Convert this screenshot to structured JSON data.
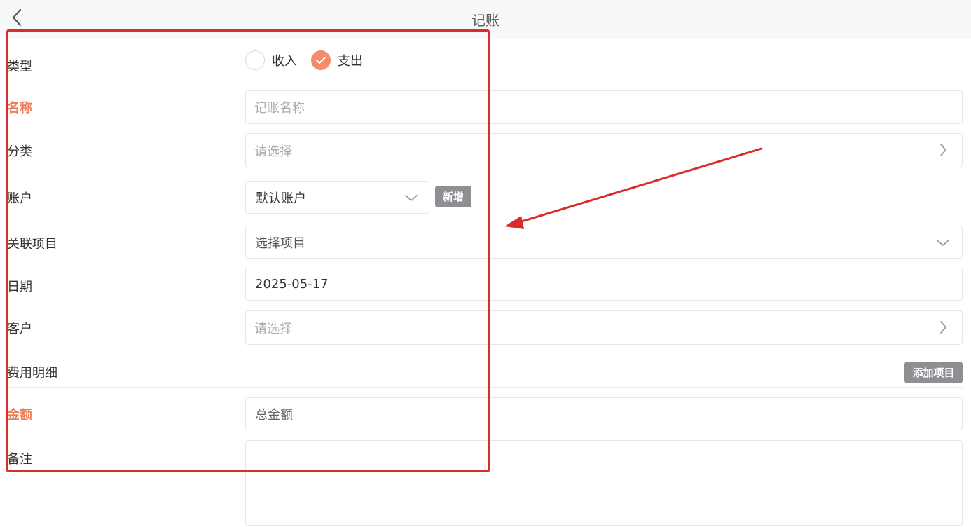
{
  "header": {
    "title": "记账",
    "back_icon": "chevron-left-icon"
  },
  "form": {
    "type": {
      "label": "类型",
      "options": [
        {
          "label": "收入",
          "checked": false
        },
        {
          "label": "支出",
          "checked": true
        }
      ]
    },
    "name": {
      "label": "名称",
      "required": true,
      "placeholder": "记账名称"
    },
    "category": {
      "label": "分类",
      "placeholder": "请选择",
      "icon": "chevron-right-icon"
    },
    "account": {
      "label": "账户",
      "value": "默认账户",
      "icon": "chevron-down-icon",
      "add_button": "新增"
    },
    "project": {
      "label": "关联项目",
      "placeholder": "选择项目",
      "icon": "chevron-down-icon"
    },
    "date": {
      "label": "日期",
      "value": "2025-05-17"
    },
    "customer": {
      "label": "客户",
      "placeholder": "请选择",
      "icon": "chevron-right-icon"
    },
    "expense_details": {
      "label": "费用明细",
      "add_button": "添加项目"
    },
    "amount": {
      "label": "金额",
      "required": true,
      "placeholder": "总金额"
    },
    "remark": {
      "label": "备注",
      "value": ""
    }
  },
  "colors": {
    "accent": "#f58c68",
    "required_label": "#f07a55",
    "annotation": "#d92c2c",
    "button_gray": "#8e8f93"
  }
}
